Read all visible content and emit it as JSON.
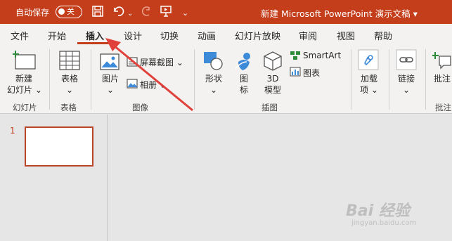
{
  "titlebar": {
    "autosave_label": "自动保存",
    "toggle_state": "关",
    "doc_title": "新建 Microsoft PowerPoint 演示文稿 ▾"
  },
  "tabs": [
    {
      "label": "文件"
    },
    {
      "label": "开始"
    },
    {
      "label": "插入"
    },
    {
      "label": "设计"
    },
    {
      "label": "切换"
    },
    {
      "label": "动画"
    },
    {
      "label": "幻灯片放映"
    },
    {
      "label": "审阅"
    },
    {
      "label": "视图"
    },
    {
      "label": "帮助"
    }
  ],
  "active_tab": "插入",
  "ribbon": {
    "new_slide": {
      "line1": "新建",
      "line2": "幻灯片 ⌄"
    },
    "table": {
      "line1": "表格",
      "line2": "⌄"
    },
    "pictures": {
      "line1": "图片",
      "line2": "⌄"
    },
    "screenshot": "屏幕截图 ⌄",
    "album": "相册 ⌄",
    "shapes": {
      "line1": "形状",
      "line2": "⌄"
    },
    "icons": {
      "line1": "图",
      "line2": "标"
    },
    "model3d": {
      "line1": "3D",
      "line2": "模型"
    },
    "smartart": "SmartArt",
    "chart": "图表",
    "addins": {
      "line1": "加载",
      "line2": "项 ⌄"
    },
    "link": {
      "line1": "链接",
      "line2": "⌄"
    },
    "comment": {
      "line1": "批注"
    },
    "groups": {
      "slides": "幻灯片",
      "tables": "表格",
      "images": "图像",
      "illustrations": "插图",
      "comments": "批注"
    }
  },
  "thumbnails": [
    {
      "number": "1"
    }
  ],
  "watermark": {
    "main": "Bai 经验",
    "sub": "jingyan.baidu.com"
  },
  "colors": {
    "accent": "#c43e1c",
    "arrow": "#e0413a",
    "ribbon_bg": "#f3f2f1",
    "workspace_bg": "#e6e6e6"
  }
}
